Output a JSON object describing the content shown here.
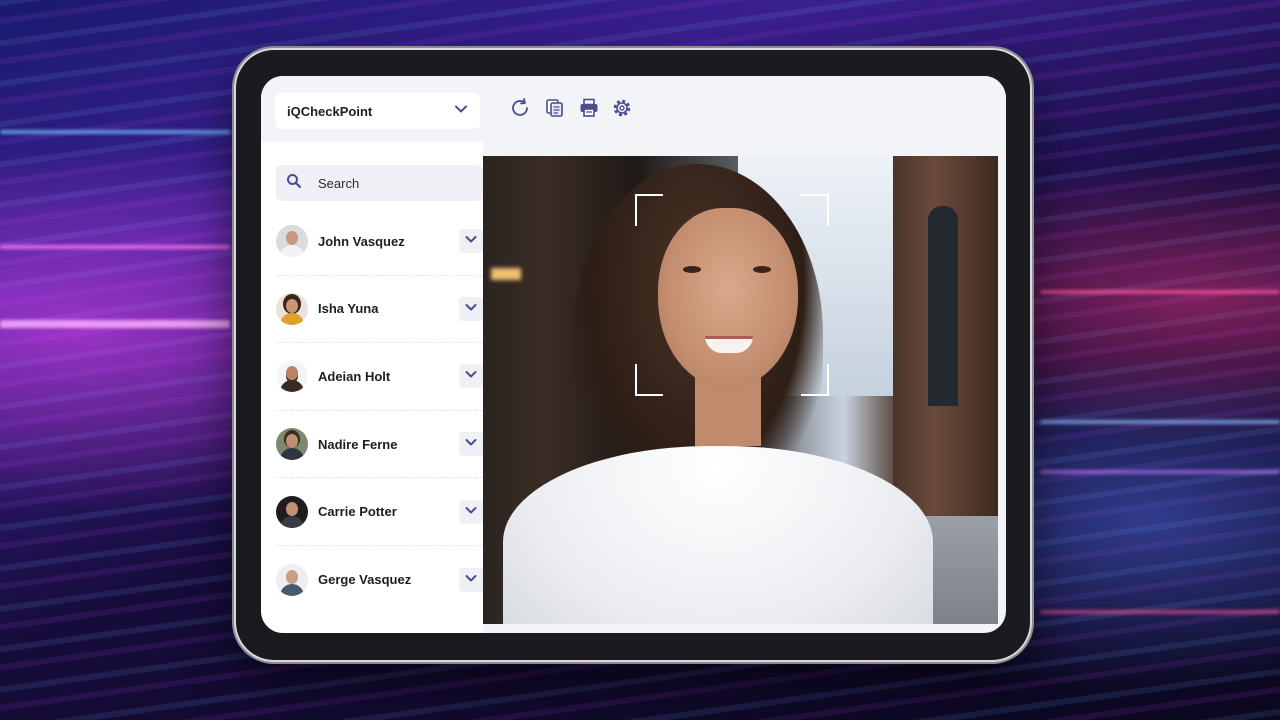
{
  "app": {
    "org_selector": {
      "label": "iQCheckPoint"
    }
  },
  "toolbar": {
    "tools": [
      {
        "icon": "refresh-icon"
      },
      {
        "icon": "copy-icon"
      },
      {
        "icon": "print-icon"
      },
      {
        "icon": "gear-icon"
      }
    ]
  },
  "sidebar": {
    "search": {
      "placeholder": "Search"
    },
    "users": [
      {
        "name": "John Vasquez"
      },
      {
        "name": "Isha Yuna"
      },
      {
        "name": "Adeian Holt"
      },
      {
        "name": "Nadire Ferne"
      },
      {
        "name": "Carrie Potter"
      },
      {
        "name": "Gerge Vasquez"
      }
    ]
  },
  "colors": {
    "accent": "#4b4d8f",
    "screen_bg": "#f3f4f8",
    "panel_bg": "#ffffff"
  }
}
